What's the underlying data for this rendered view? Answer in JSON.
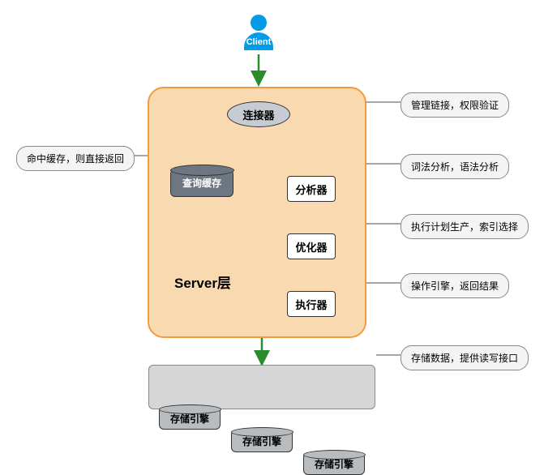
{
  "client": {
    "label": "Client"
  },
  "server": {
    "label": "Server层",
    "connector": "连接器",
    "cache": "查询缓存",
    "analyzer": "分析器",
    "optimizer": "优化器",
    "executor": "执行器"
  },
  "storage": {
    "engine1": "存储引擎",
    "engine2": "存储引擎",
    "engine3": "存储引擎"
  },
  "annotations": {
    "connector": "管理链接，权限验证",
    "cache": "命中缓存，则直接返回",
    "analyzer": "词法分析，语法分析",
    "optimizer": "执行计划生产，索引选择",
    "executor": "操作引擎，返回结果",
    "storage": "存储数据，提供读写接口"
  }
}
